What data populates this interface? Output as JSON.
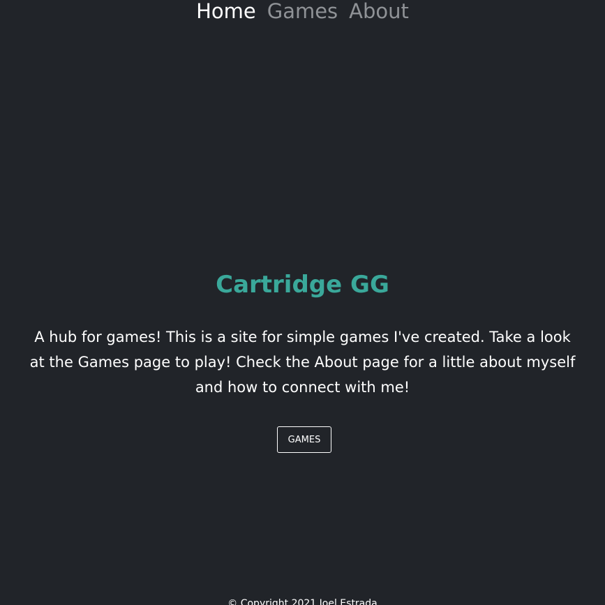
{
  "nav": {
    "items": [
      {
        "label": "Home",
        "active": true
      },
      {
        "label": "Games",
        "active": false
      },
      {
        "label": "About",
        "active": false
      }
    ]
  },
  "hero": {
    "title": "Cartridge GG",
    "text": "A hub for games! This is a site for simple games I've created. Take a look at the Games page to play! Check the About page for a little about myself and how to connect with me!",
    "button_label": "GAMES"
  },
  "footer": {
    "copyright": "© Copyright 2021 Joel Estrada"
  },
  "colors": {
    "background": "#212429",
    "accent": "#3aa89a",
    "nav_inactive": "#8f9296",
    "text": "#ffffff"
  }
}
